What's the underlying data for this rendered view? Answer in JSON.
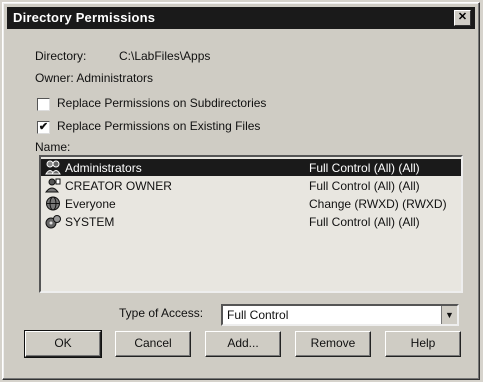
{
  "window": {
    "title": "Directory Permissions",
    "close_glyph": "✕"
  },
  "directory": {
    "label": "Directory:",
    "value": "C:\\LabFiles\\Apps"
  },
  "owner": {
    "label": "Owner: Administrators"
  },
  "options": [
    {
      "label": "Replace Permissions on Subdirectories",
      "checked": false
    },
    {
      "label": "Replace Permissions on Existing Files",
      "checked": true,
      "mark": "✔"
    }
  ],
  "names": {
    "label": "Name:",
    "entries": [
      {
        "name": "Administrators",
        "access": "Full Control (All) (All)",
        "icon": "group-icon",
        "selected": true
      },
      {
        "name": "CREATOR OWNER",
        "access": "Full Control (All) (All)",
        "icon": "creator-owner-icon",
        "selected": false
      },
      {
        "name": "Everyone",
        "access": "Change (RWXD) (RWXD)",
        "icon": "globe-icon",
        "selected": false
      },
      {
        "name": "SYSTEM",
        "access": "Full Control (All) (All)",
        "icon": "system-icon",
        "selected": false
      }
    ]
  },
  "type_of_access": {
    "label": "Type of Access:",
    "value": "Full Control"
  },
  "buttons": {
    "ok": "OK",
    "cancel": "Cancel",
    "add": "Add...",
    "remove": "Remove",
    "help": "Help"
  }
}
